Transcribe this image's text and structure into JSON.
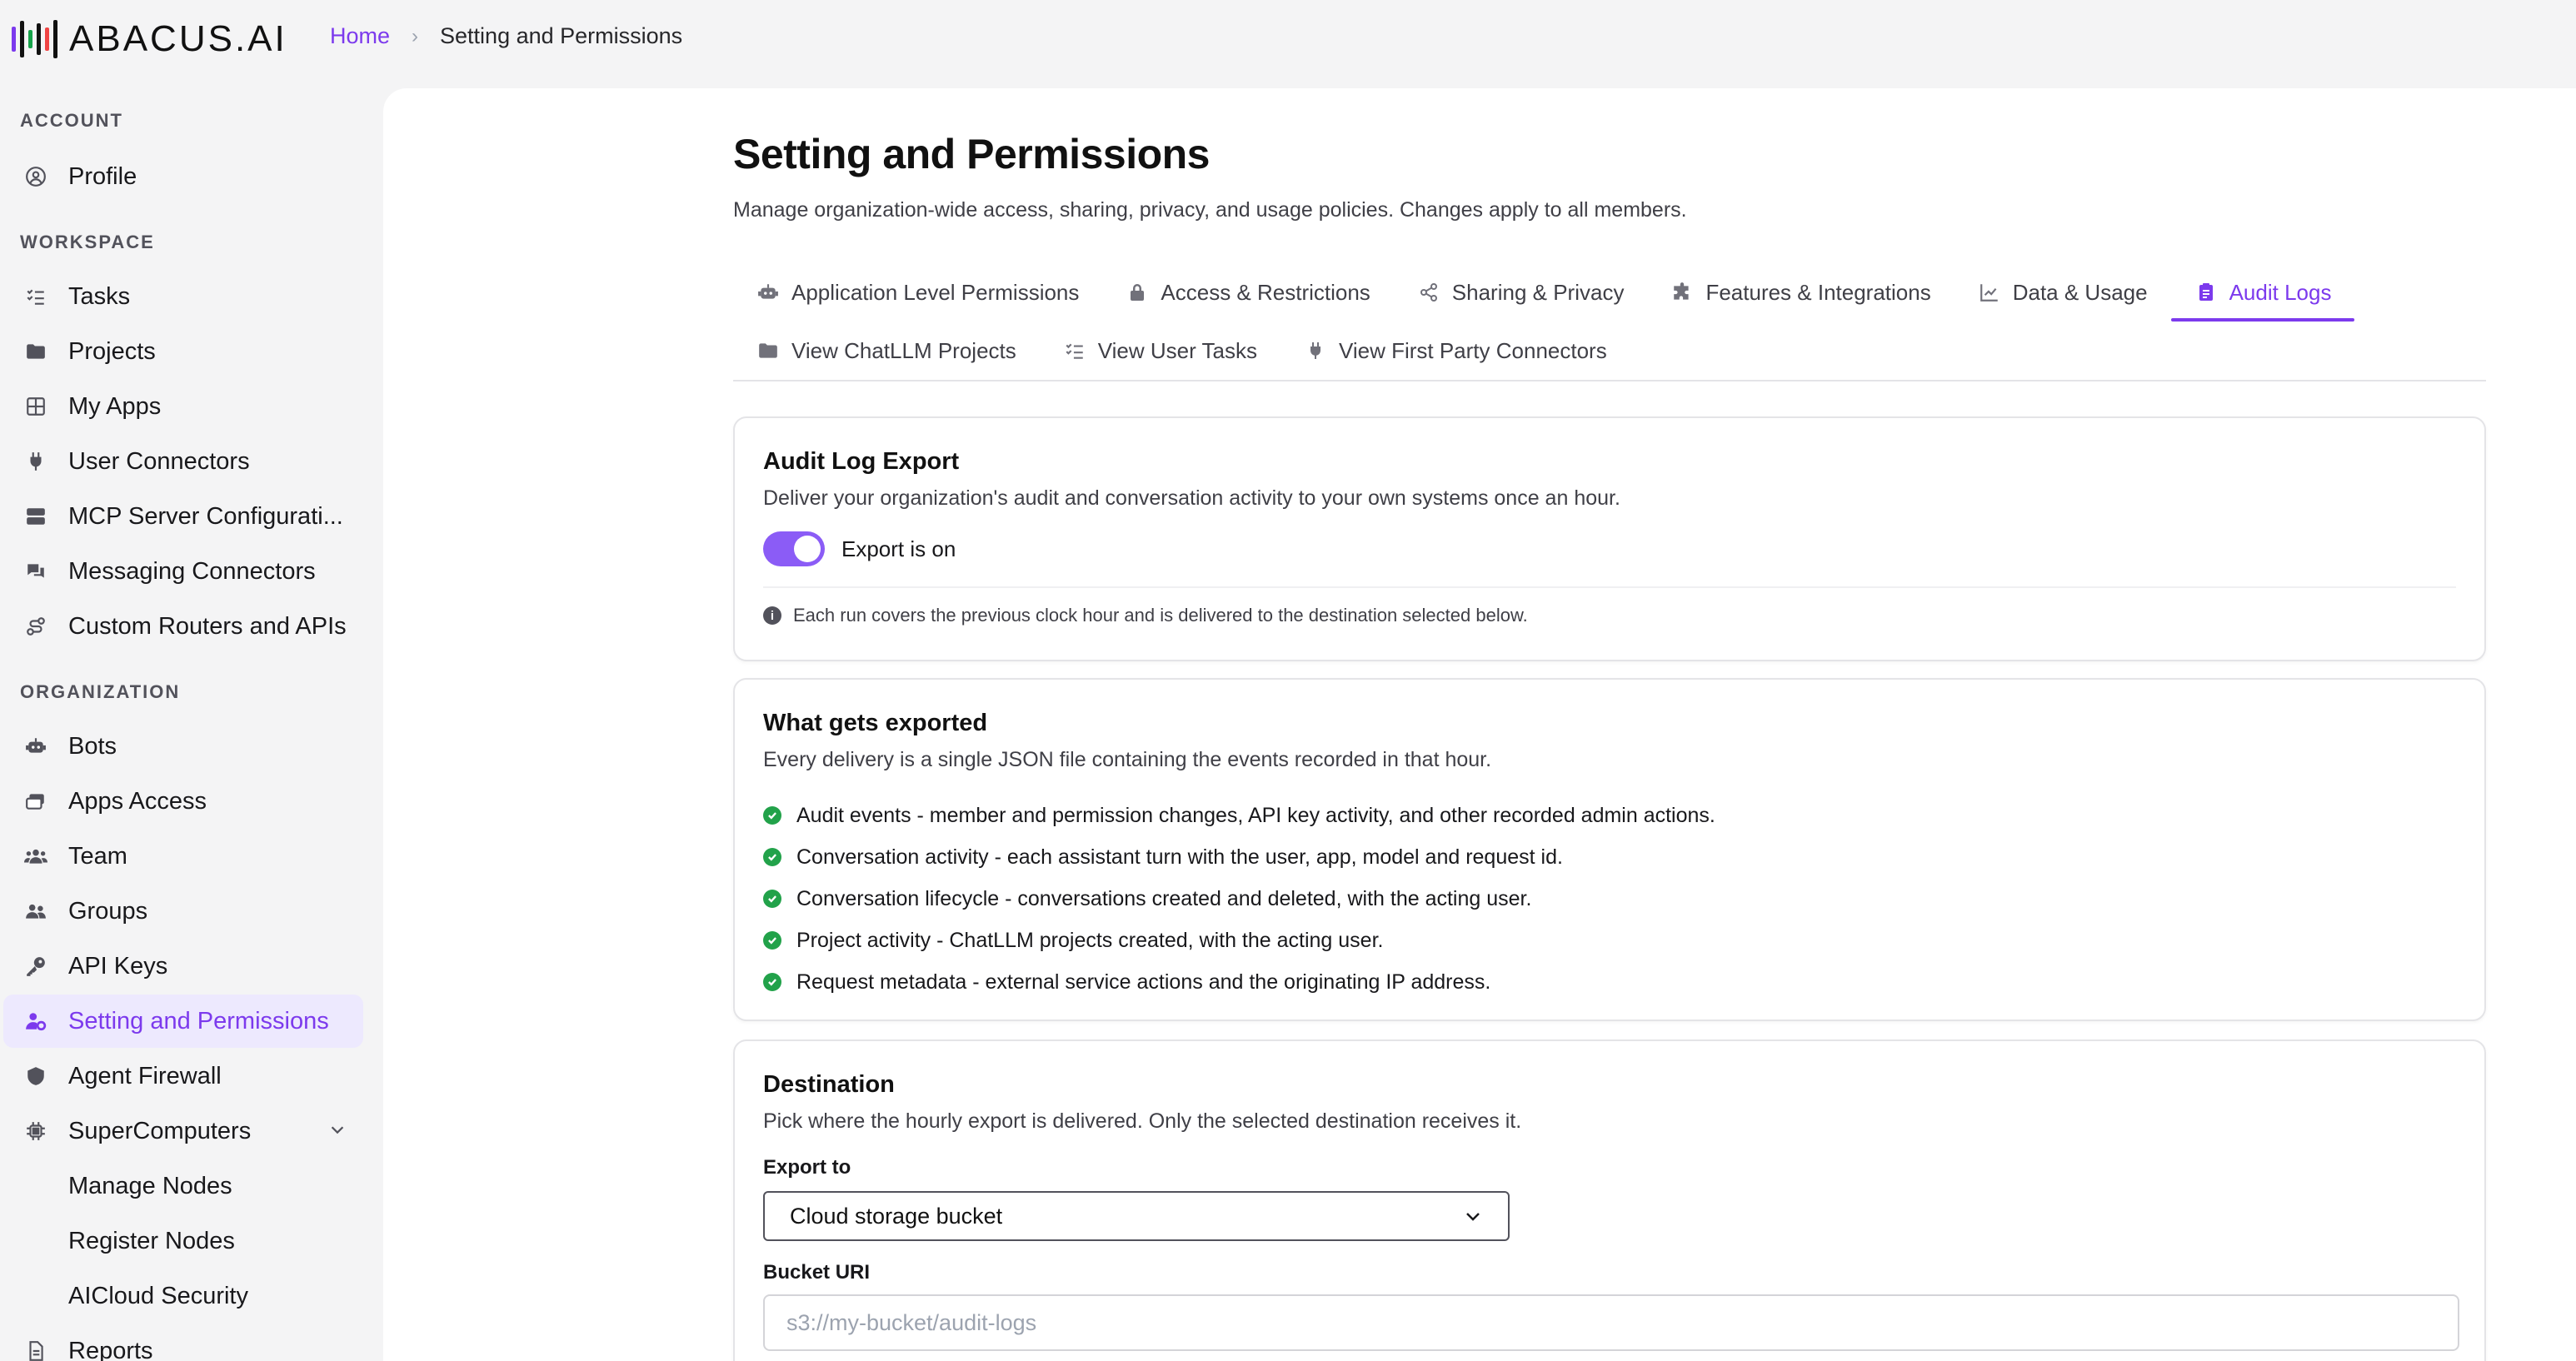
{
  "logo": {
    "text": "ABACUS.AI"
  },
  "breadcrumb": {
    "home": "Home",
    "current": "Setting and Permissions"
  },
  "sidebar": {
    "sections": {
      "account": "ACCOUNT",
      "workspace": "WORKSPACE",
      "organization": "ORGANIZATION"
    },
    "account_items": [
      {
        "label": "Profile",
        "icon": "user-circle-icon"
      }
    ],
    "workspace_items": [
      {
        "label": "Tasks",
        "icon": "list-check-icon"
      },
      {
        "label": "Projects",
        "icon": "folder-icon"
      },
      {
        "label": "My Apps",
        "icon": "grid-icon"
      },
      {
        "label": "User Connectors",
        "icon": "plug-icon"
      },
      {
        "label": "MCP Server Configurati...",
        "icon": "server-icon"
      },
      {
        "label": "Messaging Connectors",
        "icon": "chat-bubbles-icon"
      },
      {
        "label": "Custom Routers and APIs",
        "icon": "route-icon"
      }
    ],
    "organization_items": [
      {
        "label": "Bots",
        "icon": "robot-icon"
      },
      {
        "label": "Apps Access",
        "icon": "apps-access-icon"
      },
      {
        "label": "Team",
        "icon": "team-icon"
      },
      {
        "label": "Groups",
        "icon": "groups-icon"
      },
      {
        "label": "API Keys",
        "icon": "key-icon"
      },
      {
        "label": "Setting and Permissions",
        "icon": "user-gear-icon",
        "active": true
      },
      {
        "label": "Agent Firewall",
        "icon": "shield-icon"
      },
      {
        "label": "SuperComputers",
        "icon": "chip-icon"
      },
      {
        "label": "Manage Nodes"
      },
      {
        "label": "Register Nodes"
      },
      {
        "label": "AICloud Security"
      },
      {
        "label": "Reports",
        "icon": "document-icon"
      }
    ]
  },
  "page": {
    "title": "Setting and Permissions",
    "subtitle": "Manage organization-wide access, sharing, privacy, and usage policies. Changes apply to all members."
  },
  "tabs": [
    {
      "label": "Application Level Permissions",
      "icon": "robot-icon"
    },
    {
      "label": "Access & Restrictions",
      "icon": "lock-icon"
    },
    {
      "label": "Sharing & Privacy",
      "icon": "share-icon"
    },
    {
      "label": "Features & Integrations",
      "icon": "puzzle-icon"
    },
    {
      "label": "Data & Usage",
      "icon": "chart-line-icon"
    },
    {
      "label": "Audit Logs",
      "icon": "clipboard-icon",
      "active": true
    },
    {
      "label": "View ChatLLM Projects",
      "icon": "folder-icon"
    },
    {
      "label": "View User Tasks",
      "icon": "list-check-icon"
    },
    {
      "label": "View First Party Connectors",
      "icon": "plug-icon"
    }
  ],
  "audit_export": {
    "title": "Audit Log Export",
    "description": "Deliver your organization's audit and conversation activity to your own systems once an hour.",
    "toggle_label": "Export is on",
    "toggle_on": true,
    "note": "Each run covers the previous clock hour and is delivered to the destination selected below."
  },
  "what_exported": {
    "title": "What gets exported",
    "description": "Every delivery is a single JSON file containing the events recorded in that hour.",
    "items": [
      "Audit events - member and permission changes, API key activity, and other recorded admin actions.",
      "Conversation activity - each assistant turn with the user, app, model and request id.",
      "Conversation lifecycle - conversations created and deleted, with the acting user.",
      "Project activity - ChatLLM projects created, with the acting user.",
      "Request metadata - external service actions and the originating IP address."
    ]
  },
  "destination": {
    "title": "Destination",
    "description": "Pick where the hourly export is delivered. Only the selected destination receives it.",
    "export_to_label": "Export to",
    "export_to_value": "Cloud storage bucket",
    "bucket_label": "Bucket URI",
    "bucket_placeholder": "s3://my-bucket/audit-logs"
  },
  "colors": {
    "accent": "#7c3aed",
    "accent_bg": "#ede9fe",
    "toggle": "#8b5cf6",
    "check": "#22a24a"
  }
}
